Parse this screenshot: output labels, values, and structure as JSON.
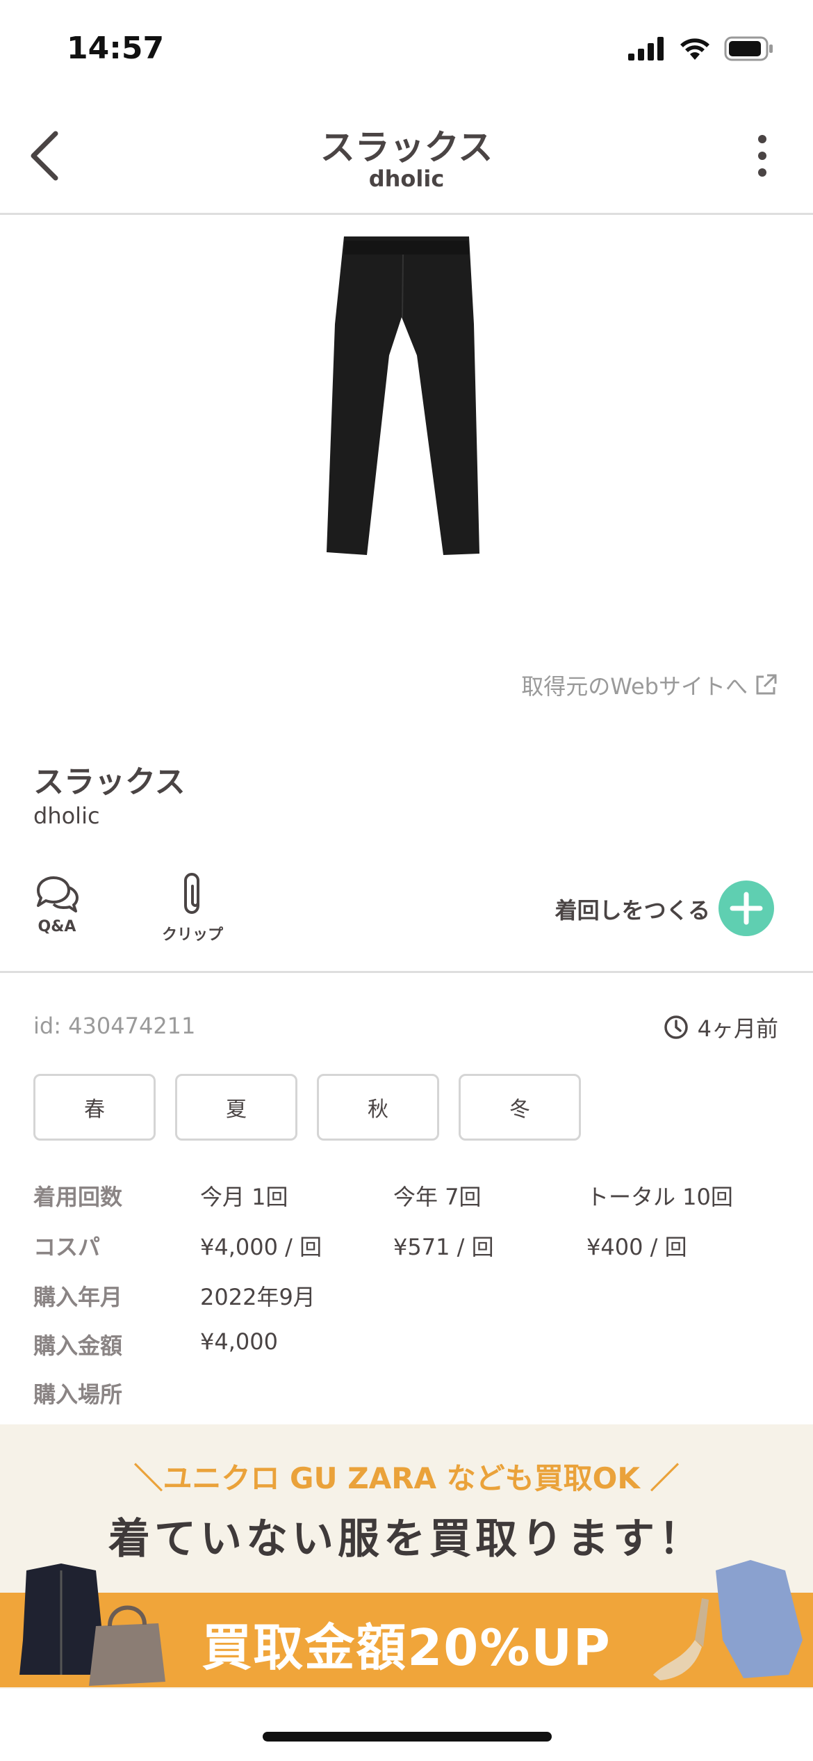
{
  "status_bar": {
    "time": "14:57"
  },
  "header": {
    "title": "スラックス",
    "subtitle": "dholic"
  },
  "web_link": "取得元のWebサイトへ",
  "item": {
    "name": "スラックス",
    "brand": "dholic"
  },
  "actions": {
    "qa": "Q&A",
    "clip": "クリップ",
    "create_coordinate": "着回しをつくる"
  },
  "meta": {
    "id": "id: 430474211",
    "updated": "4ヶ月前"
  },
  "seasons": [
    "春",
    "夏",
    "秋",
    "冬"
  ],
  "details": {
    "wear_count_label": "着用回数",
    "wear_this_month": "今月 1回",
    "wear_this_year": "今年 7回",
    "wear_total": "トータル 10回",
    "cospa_label": "コスパ",
    "cospa_month": "¥4,000 / 回",
    "cospa_year": "¥571 / 回",
    "cospa_total": "¥400 / 回",
    "purchase_date_label": "購入年月",
    "purchase_date": "2022年9月",
    "purchase_price_label": "購入金額",
    "purchase_price": "¥4,000",
    "purchase_place_label": "購入場所"
  },
  "banner": {
    "top_text": "＼ユニクロ GU ZARA なども買取OK ／",
    "main_text": "着ていない服を買取ります！",
    "cta_text": "買取金額20%UP"
  },
  "colors": {
    "accent_green": "#5fcfb1",
    "banner_orange": "#f0a53a",
    "banner_bg": "#f6f2e8"
  }
}
